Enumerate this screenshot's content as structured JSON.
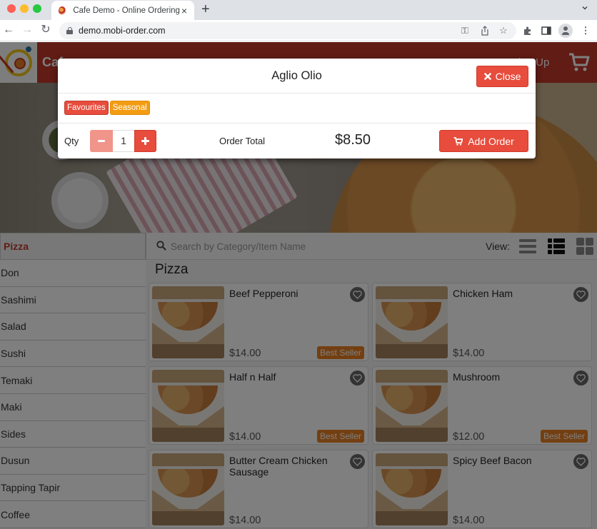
{
  "browser": {
    "tab_title": "Cafe Demo - Online Ordering",
    "url": "demo.mobi-order.com",
    "icons": [
      "back-icon",
      "forward-icon",
      "reload-icon",
      "lock-icon",
      "key-icon",
      "share-icon",
      "star-icon",
      "extensions-icon",
      "side-panel-icon",
      "profile-icon",
      "menu-icon"
    ]
  },
  "header": {
    "site_name_partial": "Cafe",
    "signup_partial": "ign Up",
    "brand_color": "#c0392b"
  },
  "modal": {
    "title": "Aglio Olio",
    "close_label": "Close",
    "tags": [
      {
        "label": "Favourites",
        "color": "#e74c3c"
      },
      {
        "label": "Seasonal",
        "color": "#f39c12"
      }
    ],
    "qty_label": "Qty",
    "qty_value": "1",
    "total_label": "Order Total",
    "total_value": "$8.50",
    "add_order_label": "Add Order"
  },
  "sidebar": {
    "categories": [
      {
        "label": "Pizza",
        "active": true
      },
      {
        "label": "Don"
      },
      {
        "label": "Sashimi"
      },
      {
        "label": "Salad"
      },
      {
        "label": "Sushi"
      },
      {
        "label": "Temaki"
      },
      {
        "label": "Maki"
      },
      {
        "label": "Sides"
      },
      {
        "label": "Dusun"
      },
      {
        "label": "Tapping Tapir"
      },
      {
        "label": "Coffee"
      }
    ]
  },
  "content": {
    "search_placeholder": "Search by Category/Item Name",
    "view_label": "View:",
    "section_title": "Pizza",
    "items": [
      {
        "name": "Beef Pepperoni",
        "price": "$14.00",
        "badge": "Best Seller"
      },
      {
        "name": "Chicken Ham",
        "price": "$14.00",
        "badge": ""
      },
      {
        "name": "Half n Half",
        "price": "$14.00",
        "badge": "Best Seller"
      },
      {
        "name": "Mushroom",
        "price": "$12.00",
        "badge": "Best Seller"
      },
      {
        "name": "Butter Cream Chicken Sausage",
        "price": "$14.00",
        "badge": ""
      },
      {
        "name": "Spicy Beef Bacon",
        "price": "$14.00",
        "badge": ""
      }
    ]
  }
}
